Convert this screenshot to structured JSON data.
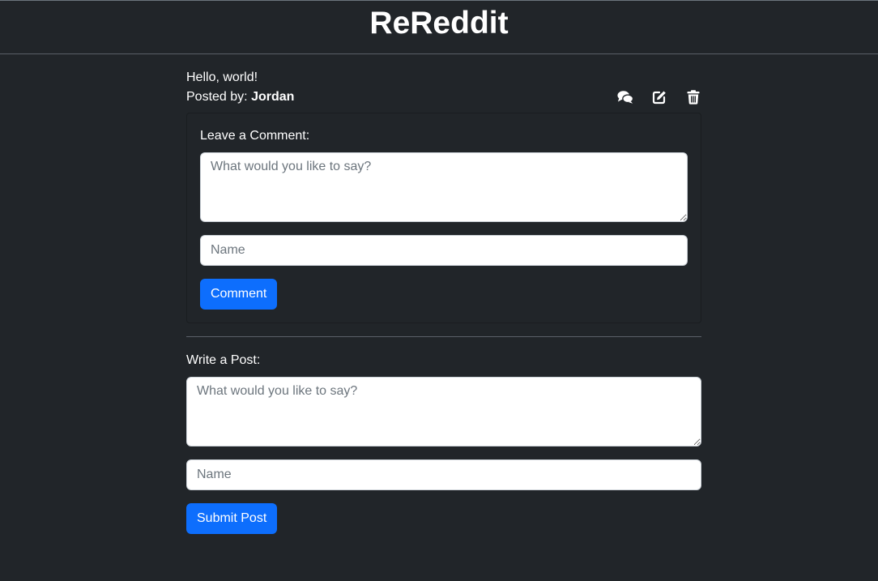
{
  "header": {
    "title": "ReReddit"
  },
  "post": {
    "title": "Hello, world!",
    "posted_by_label": "Posted by:",
    "author": "Jordan",
    "actions": {
      "comments_icon": "comments-icon",
      "edit_icon": "edit-icon",
      "delete_icon": "trash-icon"
    }
  },
  "comment_form": {
    "label": "Leave a Comment:",
    "text_placeholder": "What would you like to say?",
    "name_placeholder": "Name",
    "submit_label": "Comment"
  },
  "post_form": {
    "label": "Write a Post:",
    "text_placeholder": "What would you like to say?",
    "name_placeholder": "Name",
    "submit_label": "Submit Post"
  },
  "colors": {
    "background": "#212529",
    "primary": "#0d6efd",
    "text": "#ffffff"
  }
}
